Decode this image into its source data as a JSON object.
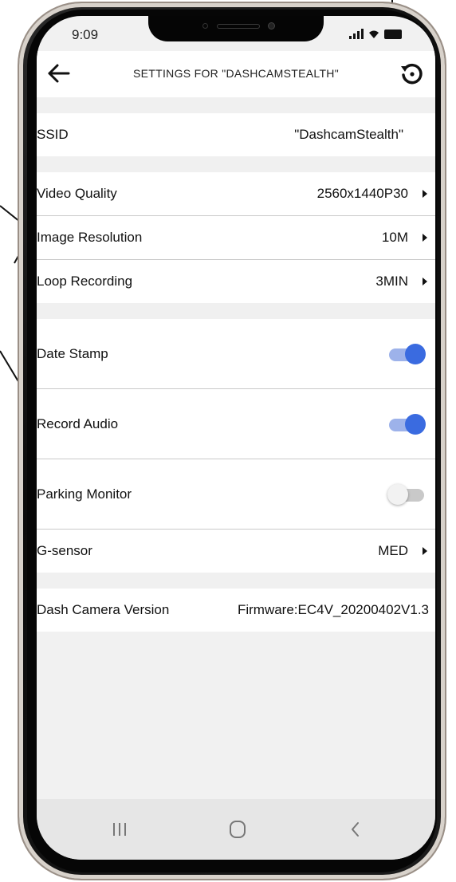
{
  "status_bar": {
    "time": "9:09"
  },
  "header": {
    "title": "SETTINGS FOR \"DASHCAMSTEALTH\""
  },
  "settings": {
    "ssid": {
      "label": "SSID",
      "value": "\"DashcamStealth\""
    },
    "video_quality": {
      "label": "Video Quality",
      "value": "2560x1440P30"
    },
    "image_resolution": {
      "label": "Image Resolution",
      "value": "10M"
    },
    "loop_recording": {
      "label": "Loop Recording",
      "value": "3MIN"
    },
    "date_stamp": {
      "label": "Date Stamp",
      "enabled": true
    },
    "record_audio": {
      "label": "Record Audio",
      "enabled": true
    },
    "parking_monitor": {
      "label": "Parking Monitor",
      "enabled": false
    },
    "g_sensor": {
      "label": "G-sensor",
      "value": "MED"
    },
    "dash_camera_version": {
      "label": "Dash Camera Version",
      "value": "Firmware:EC4V_20200402V1.3"
    }
  },
  "icons": {
    "back": "arrow-left-icon",
    "reset": "reset-history-icon",
    "nav_recent": "recent-apps-icon",
    "nav_home": "home-icon",
    "nav_back": "chevron-left-icon"
  },
  "colors": {
    "toggle_on_knob": "#3a6be0",
    "toggle_on_track": "#9db2ea",
    "toggle_off_track": "#c9c9c9",
    "section_gap": "#f0f0f0"
  }
}
